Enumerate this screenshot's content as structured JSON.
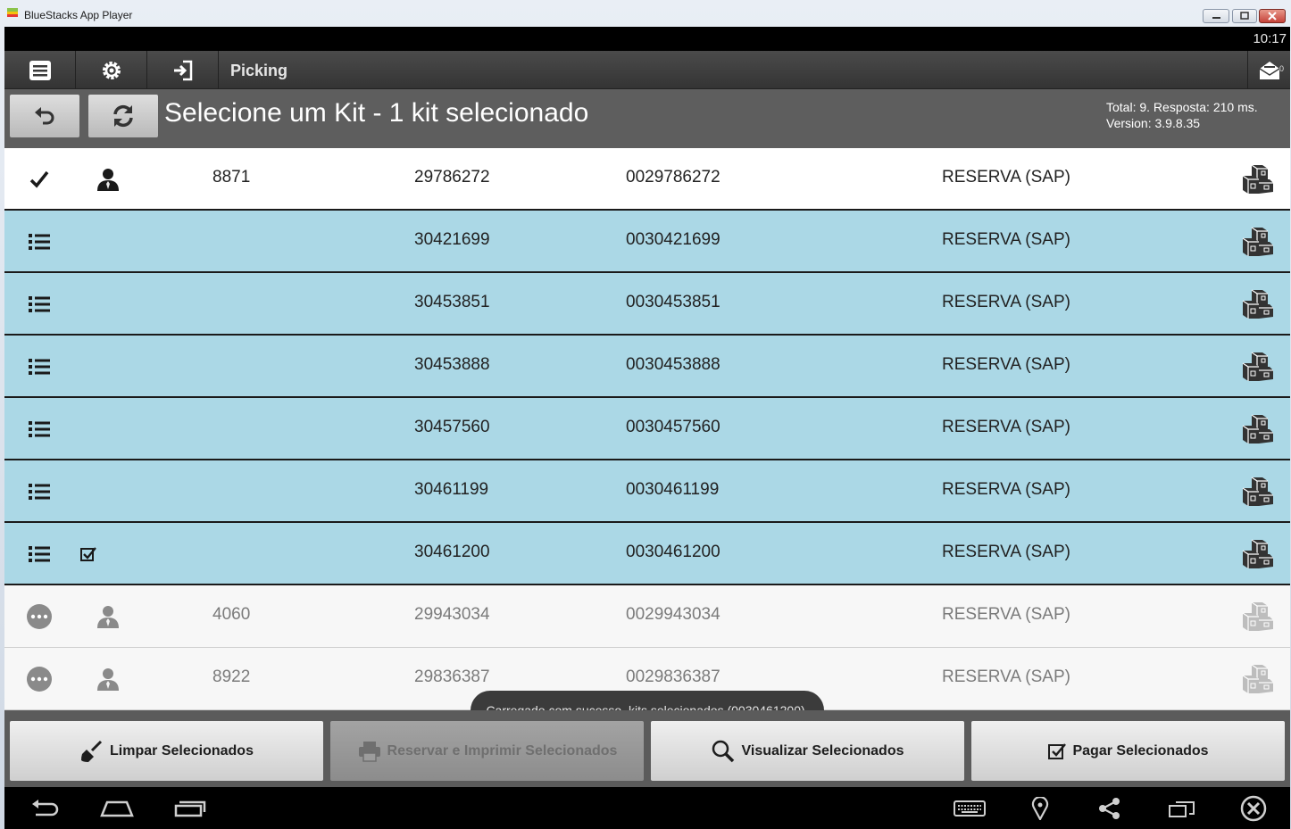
{
  "window": {
    "title": "BlueStacks App Player"
  },
  "statusbar": {
    "time": "10:17"
  },
  "actionbar": {
    "title": "Picking",
    "mail_count": "0"
  },
  "header": {
    "title": "Selecione um Kit - 1 kit selecionado",
    "info_line1": "Total: 9. Resposta: 210 ms.",
    "info_line2": "Version: 3.9.8.35"
  },
  "rows": [
    {
      "state": "selected",
      "icon1": "check-icon",
      "icon2": "person-icon",
      "col_a": "8871",
      "col_b": "29786272",
      "col_c": "0029786272",
      "col_d": "RESERVA (SAP)"
    },
    {
      "state": "blue",
      "icon1": "list-icon",
      "icon2": "",
      "col_a": "",
      "col_b": "30421699",
      "col_c": "0030421699",
      "col_d": "RESERVA (SAP)"
    },
    {
      "state": "blue",
      "icon1": "list-icon",
      "icon2": "",
      "col_a": "",
      "col_b": "30453851",
      "col_c": "0030453851",
      "col_d": "RESERVA (SAP)"
    },
    {
      "state": "blue",
      "icon1": "list-icon",
      "icon2": "",
      "col_a": "",
      "col_b": "30453888",
      "col_c": "0030453888",
      "col_d": "RESERVA (SAP)"
    },
    {
      "state": "blue",
      "icon1": "list-icon",
      "icon2": "",
      "col_a": "",
      "col_b": "30457560",
      "col_c": "0030457560",
      "col_d": "RESERVA (SAP)"
    },
    {
      "state": "blue",
      "icon1": "list-icon",
      "icon2": "",
      "col_a": "",
      "col_b": "30461199",
      "col_c": "0030461199",
      "col_d": "RESERVA (SAP)"
    },
    {
      "state": "blue",
      "icon1": "list-icon",
      "icon2": "checkbox-checked-icon",
      "col_a": "",
      "col_b": "30461200",
      "col_c": "0030461200",
      "col_d": "RESERVA (SAP)"
    },
    {
      "state": "gray",
      "icon1": "more-icon",
      "icon2": "person-icon",
      "col_a": "4060",
      "col_b": "29943034",
      "col_c": "0029943034",
      "col_d": "RESERVA (SAP)"
    },
    {
      "state": "gray",
      "icon1": "more-icon",
      "icon2": "person-icon",
      "col_a": "8922",
      "col_b": "29836387",
      "col_c": "0029836387",
      "col_d": "RESERVA (SAP)"
    }
  ],
  "toast": {
    "text": "Carregado com sucesso, kits selecionados (0030461200)."
  },
  "bottom_buttons": {
    "clear": "Limpar Selecionados",
    "reserve_print": "Reservar e Imprimir Selecionados",
    "view": "Visualizar Selecionados",
    "pay": "Pagar Selecionados"
  },
  "colors": {
    "row_blue": "#abd8e6",
    "header_bg": "#5e5e5e",
    "actionbar_bg": "#3f3f3f"
  }
}
